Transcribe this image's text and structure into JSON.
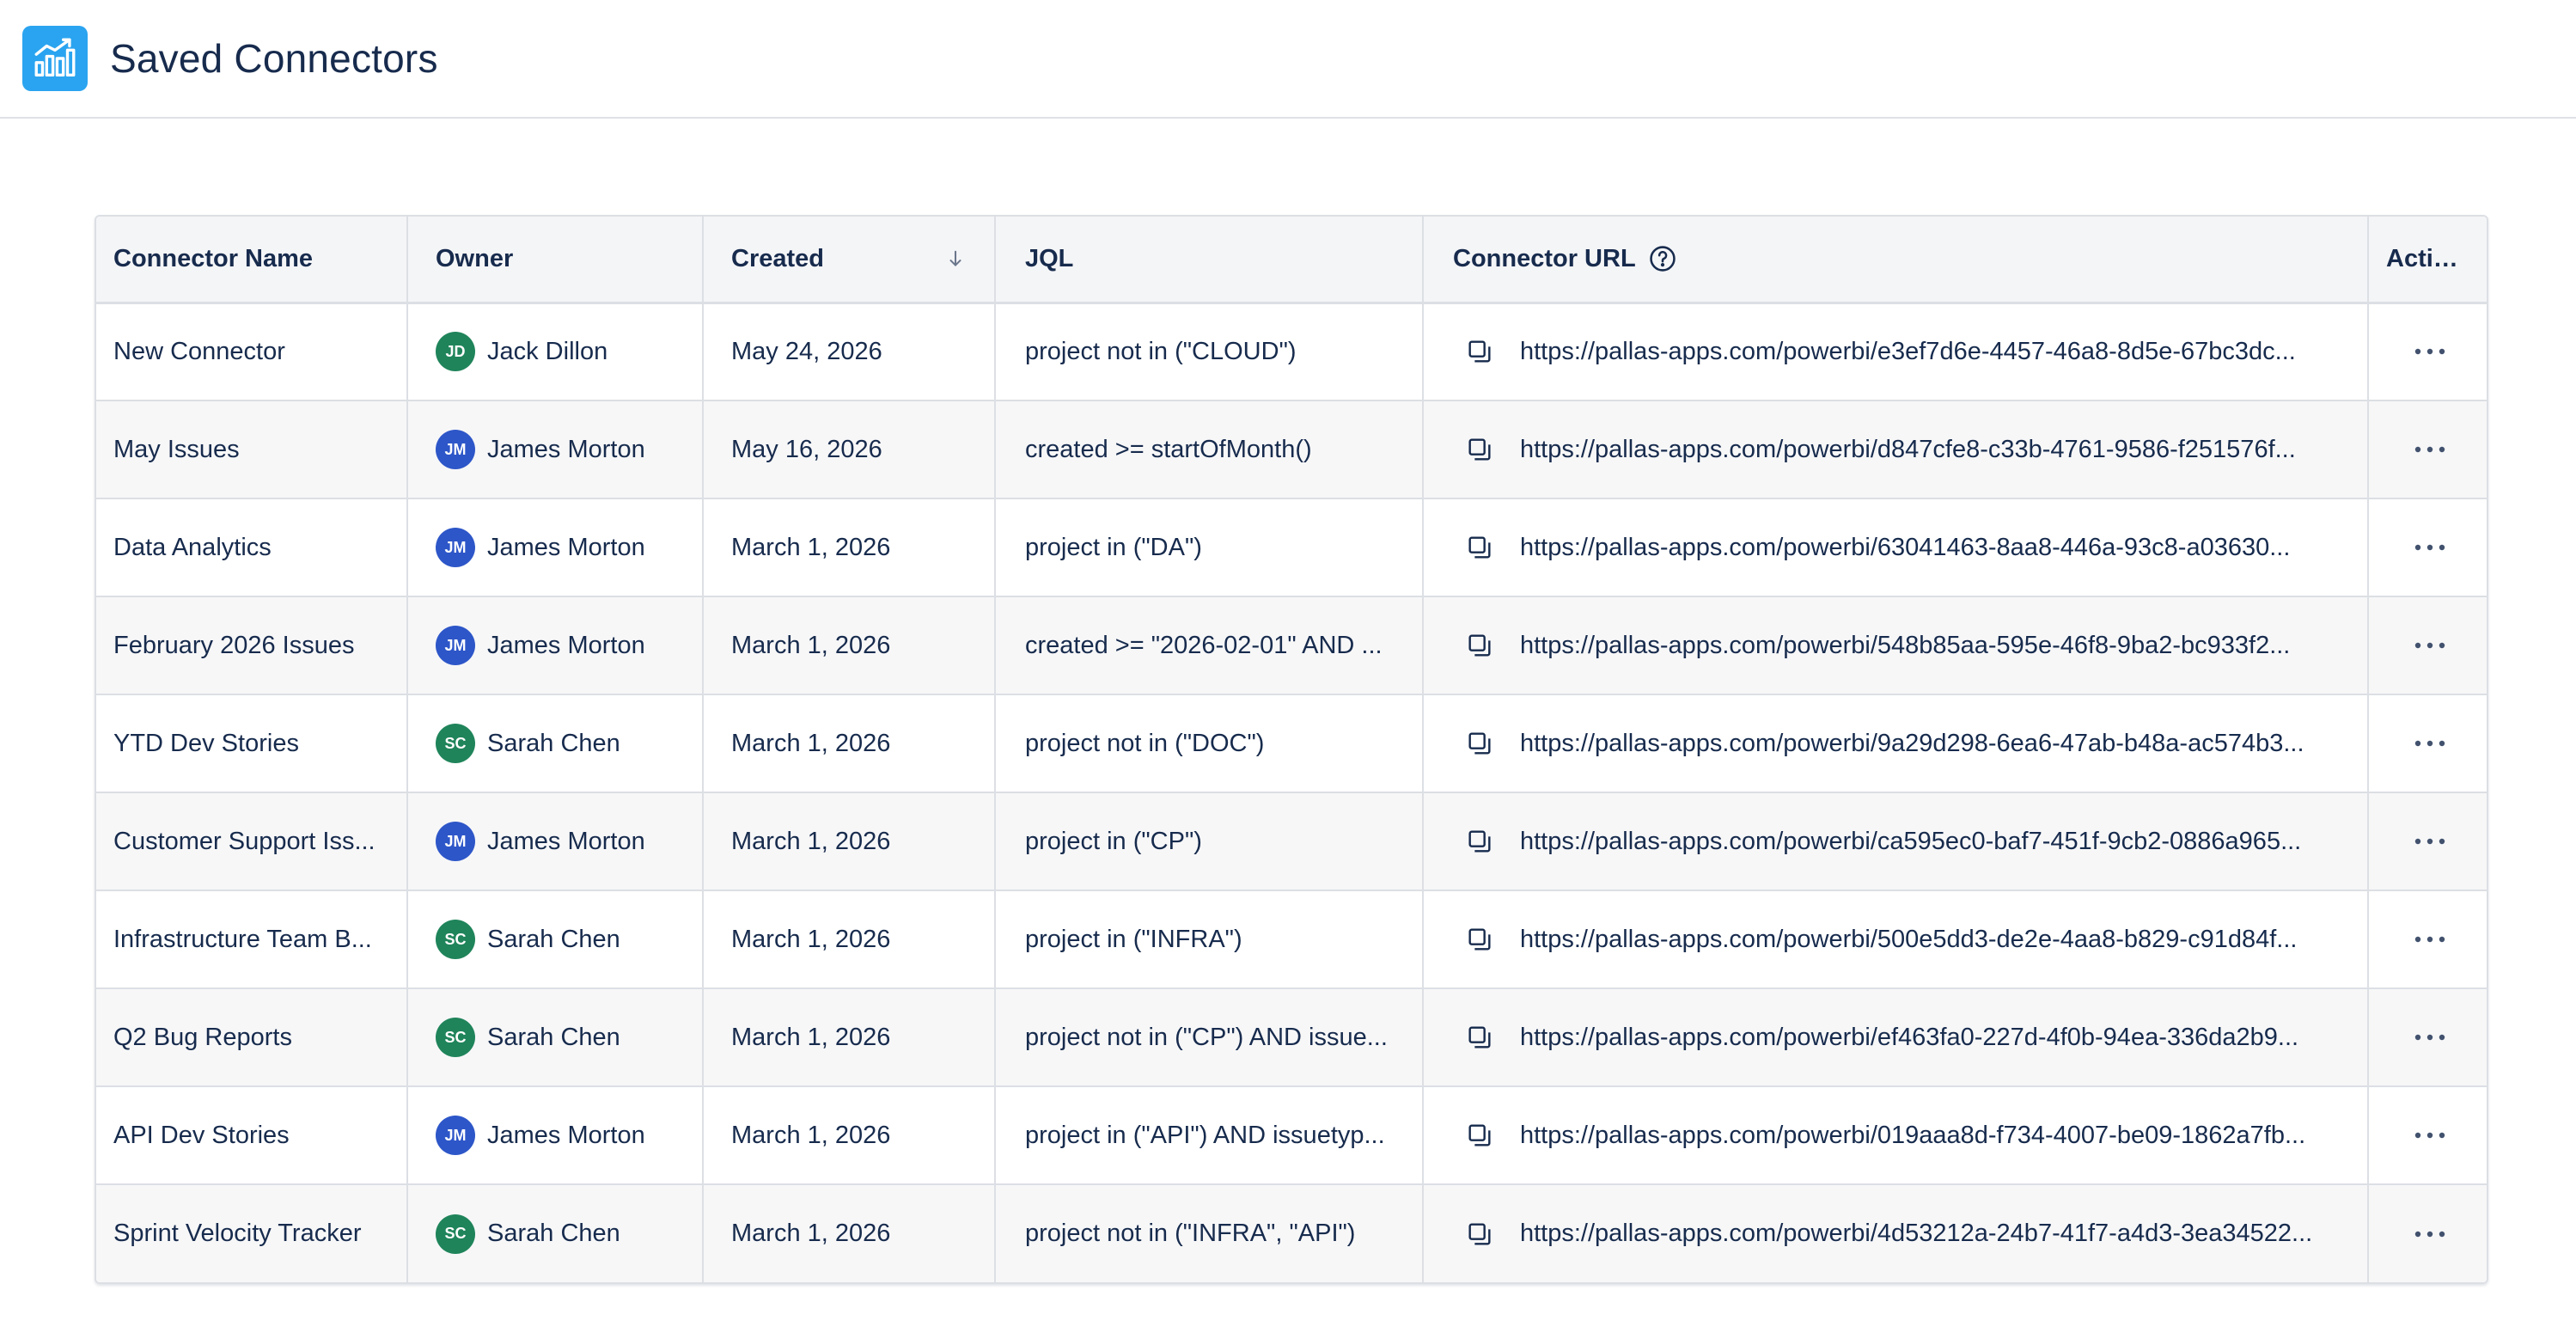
{
  "header": {
    "title": "Saved Connectors",
    "app_icon": "bar-chart-icon",
    "app_icon_color": "#2aa4f0"
  },
  "table": {
    "columns": {
      "name": "Connector Name",
      "owner": "Owner",
      "created": "Created",
      "jql": "JQL",
      "url": "Connector URL",
      "actions": "Actions"
    },
    "sort": {
      "column": "Created",
      "direction": "descending"
    },
    "rows": [
      {
        "name": "New Connector",
        "owner_initials": "JD",
        "owner": "Jack Dillon",
        "avatar_color": "#1f845a",
        "created": "May 24, 2026",
        "jql": "project not in (\"CLOUD\")",
        "url": "https://pallas-apps.com/powerbi/e3ef7d6e-4457-46a8-8d5e-67bc3dc..."
      },
      {
        "name": "May Issues",
        "owner_initials": "JM",
        "owner": "James Morton",
        "avatar_color": "#2d56c8",
        "created": "May 16, 2026",
        "jql": "created >= startOfMonth()",
        "url": "https://pallas-apps.com/powerbi/d847cfe8-c33b-4761-9586-f251576f..."
      },
      {
        "name": "Data Analytics",
        "owner_initials": "JM",
        "owner": "James Morton",
        "avatar_color": "#2d56c8",
        "created": "March 1, 2026",
        "jql": "project in (\"DA\")",
        "url": "https://pallas-apps.com/powerbi/63041463-8aa8-446a-93c8-a03630..."
      },
      {
        "name": "February 2026 Issues",
        "owner_initials": "JM",
        "owner": "James Morton",
        "avatar_color": "#2d56c8",
        "created": "March 1, 2026",
        "jql": "created >= \"2026-02-01\" AND ...",
        "url": "https://pallas-apps.com/powerbi/548b85aa-595e-46f8-9ba2-bc933f2..."
      },
      {
        "name": "YTD Dev Stories",
        "owner_initials": "SC",
        "owner": "Sarah Chen",
        "avatar_color": "#1f845a",
        "created": "March 1, 2026",
        "jql": "project not in (\"DOC\")",
        "url": "https://pallas-apps.com/powerbi/9a29d298-6ea6-47ab-b48a-ac574b3..."
      },
      {
        "name": "Customer Support Iss...",
        "owner_initials": "JM",
        "owner": "James Morton",
        "avatar_color": "#2d56c8",
        "created": "March 1, 2026",
        "jql": "project in (\"CP\")",
        "url": "https://pallas-apps.com/powerbi/ca595ec0-baf7-451f-9cb2-0886a965..."
      },
      {
        "name": "Infrastructure Team B...",
        "owner_initials": "SC",
        "owner": "Sarah Chen",
        "avatar_color": "#1f845a",
        "created": "March 1, 2026",
        "jql": "project in (\"INFRA\")",
        "url": "https://pallas-apps.com/powerbi/500e5dd3-de2e-4aa8-b829-c91d84f..."
      },
      {
        "name": "Q2 Bug Reports",
        "owner_initials": "SC",
        "owner": "Sarah Chen",
        "avatar_color": "#1f845a",
        "created": "March 1, 2026",
        "jql": "project not in (\"CP\") AND issue...",
        "url": "https://pallas-apps.com/powerbi/ef463fa0-227d-4f0b-94ea-336da2b9..."
      },
      {
        "name": "API Dev Stories",
        "owner_initials": "JM",
        "owner": "James Morton",
        "avatar_color": "#2d56c8",
        "created": "March 1, 2026",
        "jql": "project in (\"API\") AND issuetyp...",
        "url": "https://pallas-apps.com/powerbi/019aaa8d-f734-4007-be09-1862a7fb..."
      },
      {
        "name": "Sprint Velocity Tracker",
        "owner_initials": "SC",
        "owner": "Sarah Chen",
        "avatar_color": "#1f845a",
        "created": "March 1, 2026",
        "jql": "project not in (\"INFRA\", \"API\")",
        "url": "https://pallas-apps.com/powerbi/4d53212a-24b7-41f7-a4d3-3ea34522..."
      }
    ]
  }
}
